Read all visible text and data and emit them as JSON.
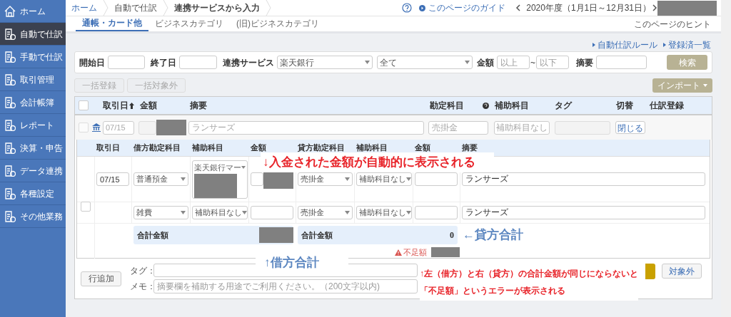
{
  "sidebar": {
    "items": [
      {
        "label": "ホーム",
        "selected": false
      },
      {
        "label": "自動で仕訳",
        "selected": true
      },
      {
        "label": "手動で仕訳",
        "selected": false
      },
      {
        "label": "取引管理",
        "selected": false
      },
      {
        "label": "会計帳簿",
        "selected": false
      },
      {
        "label": "レポート",
        "selected": false
      },
      {
        "label": "決算・申告",
        "selected": false
      },
      {
        "label": "データ連携",
        "selected": false
      },
      {
        "label": "各種設定",
        "selected": false
      },
      {
        "label": "その他業務",
        "selected": false
      }
    ]
  },
  "breadcrumb": [
    "ホーム",
    "自動で仕訳",
    "連携サービスから入力"
  ],
  "header": {
    "guide_link": "このページのガイド",
    "fiscal_year": "2020年度（1月1日～12月31日）",
    "hint_link": "このページのヒント"
  },
  "tabs": [
    {
      "label": "通帳・カード他",
      "selected": true
    },
    {
      "label": "ビジネスカテゴリ",
      "selected": false
    },
    {
      "label": "(旧)ビジネスカテゴリ",
      "selected": false
    }
  ],
  "links": [
    "自動仕訳ルール",
    "登録済一覧"
  ],
  "filters": {
    "start_label": "開始日",
    "end_label": "終了日",
    "service_label": "連携サービス",
    "service_value": "楽天銀行",
    "status_value": "全て",
    "amount_label": "金額",
    "amount_min_placeholder": "以上",
    "tilde": "~",
    "amount_max_placeholder": "以下",
    "summary_label": "摘要",
    "search_button": "検索"
  },
  "bulk_buttons": [
    {
      "label": "一括登録",
      "disabled": true
    },
    {
      "label": "一括対象外",
      "disabled": true
    }
  ],
  "import_button": "インポート",
  "table": {
    "columns": [
      "取引日",
      "金額",
      "摘要",
      "勘定科目",
      "補助科目",
      "タグ",
      "切替",
      "仕訳登録"
    ],
    "all_checked": false,
    "row": {
      "checked": false,
      "date": "07/15",
      "summary": "ランサーズ",
      "account": "売掛金",
      "sub_account": "補助科目なし",
      "toggle_button": "閉じる"
    }
  },
  "journal": {
    "columns": [
      "取引日",
      "借方勘定科目",
      "補助科目",
      "金額",
      "貸方勘定科目",
      "補助科目",
      "金額",
      "摘要"
    ],
    "rows": [
      {
        "date": "07/15",
        "debit_account": "普通預金",
        "debit_sub": "楽天銀行マー",
        "credit_account": "売掛金",
        "credit_sub": "補助科目なし",
        "summary": "ランサーズ"
      },
      {
        "checked": false,
        "debit_account": "雑費",
        "debit_sub": "補助科目なし",
        "credit_account": "売掛金",
        "credit_sub": "補助科目なし",
        "summary": "ランサーズ"
      }
    ],
    "debit_total_label": "合計金額",
    "credit_total_label": "合計金額",
    "credit_total": "0",
    "deficit_label": "不足額"
  },
  "footer": {
    "add_row_button": "行追加",
    "tag_label": "タグ：",
    "memo_label": "メモ：",
    "memo_placeholder": "摘要欄を補助する用途でご利用ください。（200文字以内)",
    "exclude_button": "対象外"
  },
  "annotations": {
    "amount_note": "↓入金された金額が自動的に表示される",
    "debit_total": "↑借方合計",
    "credit_total": "←貸方合計",
    "error_note": [
      "↑左（借方）と右（貸方）の合計金額が同じにならないと",
      "「不足額」というエラーが表示される"
    ]
  }
}
